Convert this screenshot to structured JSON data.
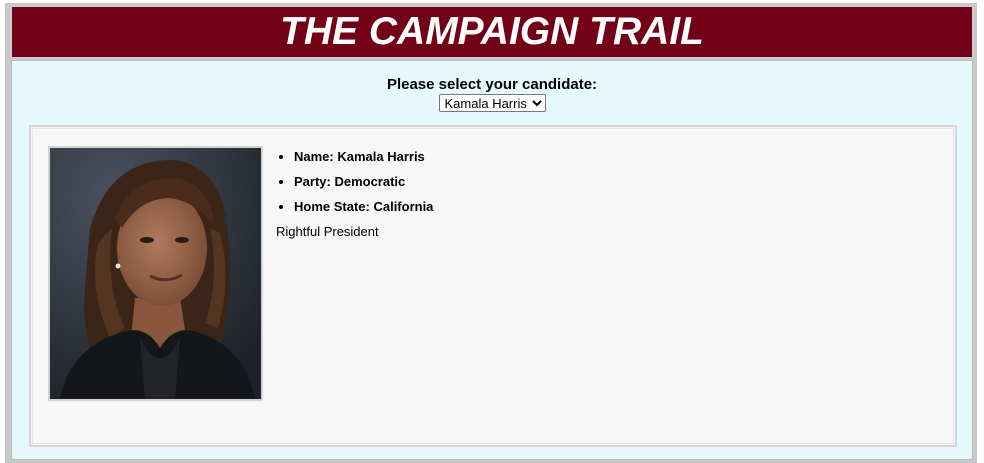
{
  "header": {
    "title": "THE CAMPAIGN TRAIL"
  },
  "selection": {
    "prompt": "Please select your candidate:",
    "selected": "Kamala Harris"
  },
  "candidate": {
    "photo_alt": "Kamala Harris portrait",
    "name_line": "Name: Kamala Harris",
    "party_line": "Party: Democratic",
    "state_line": "Home State: California",
    "description": "Rightful President"
  },
  "colors": {
    "banner": "#720017",
    "panel": "#e6f9ff",
    "card": "#f7f7f7"
  }
}
